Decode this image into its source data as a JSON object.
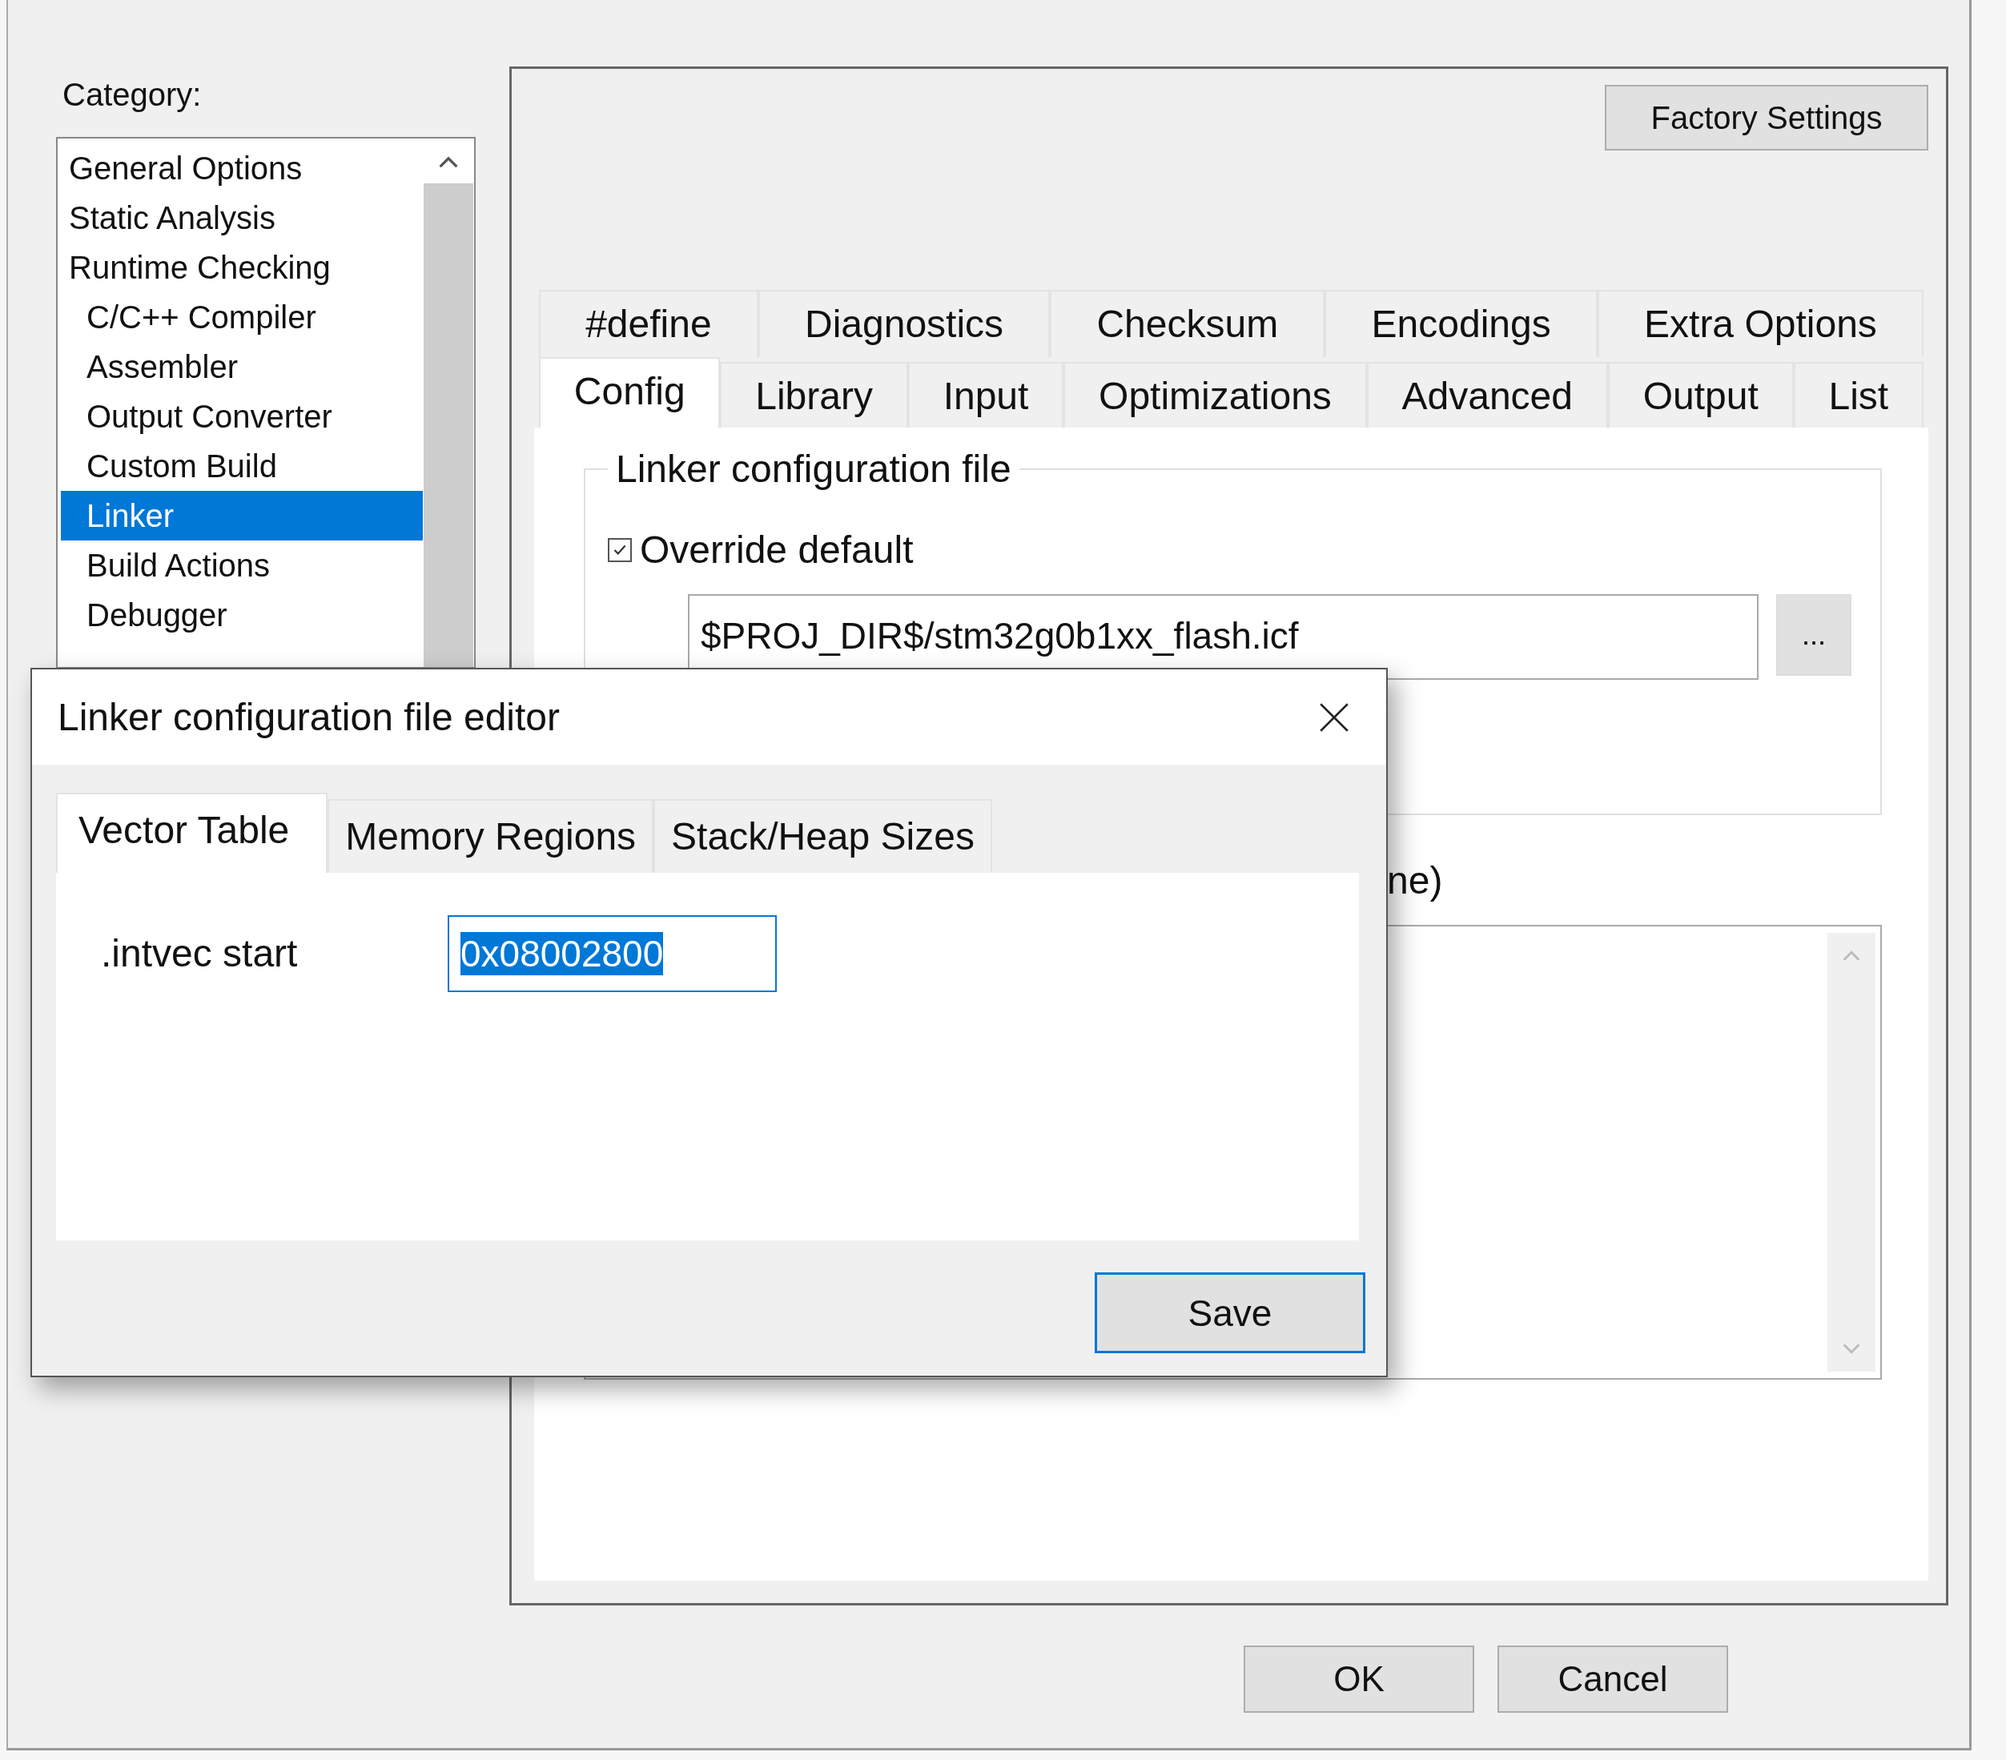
{
  "category_label": "Category:",
  "categories": [
    {
      "label": "General Options",
      "selected": false
    },
    {
      "label": "Static Analysis",
      "selected": false
    },
    {
      "label": "Runtime Checking",
      "selected": false,
      "children": [
        {
          "label": "C/C++ Compiler",
          "selected": false
        },
        {
          "label": "Assembler",
          "selected": false
        },
        {
          "label": "Output Converter",
          "selected": false
        },
        {
          "label": "Custom Build",
          "selected": false
        },
        {
          "label": "Linker",
          "selected": true
        },
        {
          "label": "Build Actions",
          "selected": false
        },
        {
          "label": "Debugger",
          "selected": false
        }
      ]
    }
  ],
  "factory_button": "Factory Settings",
  "tab_rows": [
    [
      {
        "label": "#define",
        "selected": false
      },
      {
        "label": "Diagnostics",
        "selected": false
      },
      {
        "label": "Checksum",
        "selected": false
      },
      {
        "label": "Encodings",
        "selected": false
      },
      {
        "label": "Extra Options",
        "selected": false
      }
    ],
    [
      {
        "label": "Config",
        "selected": true
      },
      {
        "label": "Library",
        "selected": false
      },
      {
        "label": "Input",
        "selected": false
      },
      {
        "label": "Optimizations",
        "selected": false
      },
      {
        "label": "Advanced",
        "selected": false
      },
      {
        "label": "Output",
        "selected": false
      },
      {
        "label": "List",
        "selected": false
      }
    ]
  ],
  "config_group": {
    "title": "Linker configuration file",
    "override": {
      "label": "Override default",
      "checked": true
    },
    "path": "$PROJ_DIR$/stm32g0b1xx_flash.icf",
    "browse": "..."
  },
  "second_label": "ne)",
  "buttons": [
    "OK",
    "Cancel"
  ],
  "dialog": {
    "title": "Linker configuration file editor",
    "tabs": [
      {
        "label": "Vector Table",
        "selected": true
      },
      {
        "label": "Memory Regions",
        "selected": false
      },
      {
        "label": "Stack/Heap Sizes",
        "selected": false
      }
    ],
    "field": {
      "label": ".intvec start",
      "value": "0x08002800",
      "focused": true,
      "text_selected": true
    },
    "save": {
      "label": "Save",
      "default": true
    }
  }
}
